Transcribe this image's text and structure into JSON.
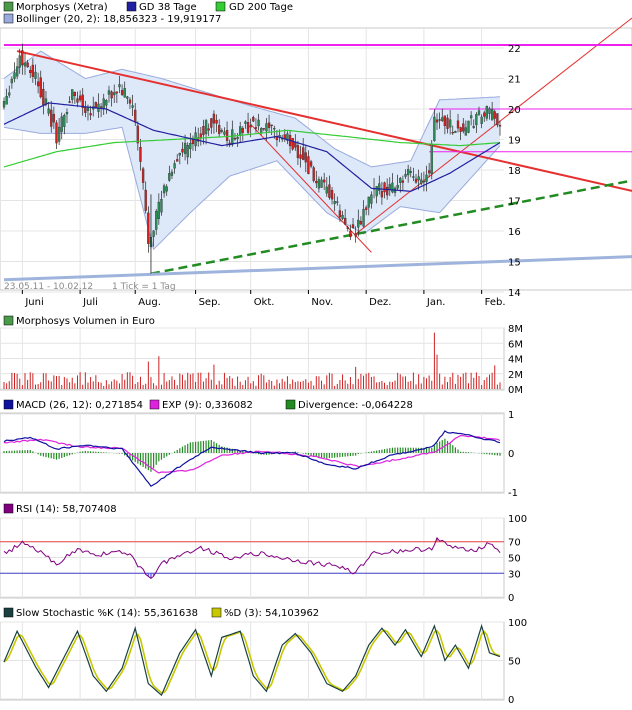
{
  "colors": {
    "price_up": "#2e8b57",
    "price_down": "#d02020",
    "gd38": "#2020a0",
    "gd200": "#33cc33",
    "bollinger_fill": "#dde8f8",
    "bollinger_line": "#99aadd",
    "trend_red": "#e53030",
    "trend_green": "#228b22",
    "trend_steel": "#9fb4dd",
    "magenta": "#ee22ee",
    "volume": "#cc2222",
    "macd": "#1010a0",
    "exp": "#dd22dd",
    "divergence": "#228b22",
    "rsi": "#800080",
    "rsi_70": "#ee4444",
    "rsi_30": "#4444cc",
    "stoch_k": "#1a4040",
    "stoch_d": "#c8c800"
  },
  "chart_data": [
    {
      "type": "line",
      "panel": "price",
      "legend": [
        {
          "label": "Morphosys (Xetra)",
          "color": "#4a9a4a"
        },
        {
          "label": "GD 38 Tage",
          "color": "#2020a0"
        },
        {
          "label": "GD 200 Tage",
          "color": "#33cc33"
        },
        {
          "label": "Bollinger (20, 2): 18,856323 - 19,919177",
          "color": "#99aadd"
        }
      ],
      "x_labels": [
        "Juni",
        "Juli",
        "Aug.",
        "Sep.",
        "Okt.",
        "Nov.",
        "Dez.",
        "Jan.",
        "Feb."
      ],
      "y_ticks": [
        "22",
        "21",
        "20",
        "19",
        "18",
        "17",
        "16",
        "15",
        "14"
      ],
      "ylim": [
        14,
        22
      ],
      "date_range_label": "23.05.11 - 10.02.12",
      "tick_label": "1 Tick = 1 Tag",
      "close_anchors": [
        [
          "2011-05-23",
          20.3
        ],
        [
          "2011-05-31",
          21.7
        ],
        [
          "2011-06-08",
          21.1
        ],
        [
          "2011-06-20",
          19.1
        ],
        [
          "2011-06-28",
          20.5
        ],
        [
          "2011-07-06",
          20.0
        ],
        [
          "2011-07-14",
          20.2
        ],
        [
          "2011-07-22",
          20.7
        ],
        [
          "2011-07-29",
          20.1
        ],
        [
          "2011-08-04",
          17.5
        ],
        [
          "2011-08-08",
          15.7
        ],
        [
          "2011-08-12",
          16.8
        ],
        [
          "2011-08-22",
          18.3
        ],
        [
          "2011-09-01",
          19.0
        ],
        [
          "2011-09-09",
          19.6
        ],
        [
          "2011-09-19",
          19.0
        ],
        [
          "2011-09-30",
          19.5
        ],
        [
          "2011-10-10",
          19.3
        ],
        [
          "2011-10-20",
          19.0
        ],
        [
          "2011-10-28",
          18.4
        ],
        [
          "2011-11-04",
          17.6
        ],
        [
          "2011-11-14",
          17.1
        ],
        [
          "2011-11-21",
          16.2
        ],
        [
          "2011-11-25",
          15.9
        ],
        [
          "2011-12-05",
          17.2
        ],
        [
          "2011-12-15",
          17.5
        ],
        [
          "2011-12-23",
          17.8
        ],
        [
          "2011-12-30",
          17.7
        ],
        [
          "2012-01-04",
          18.1
        ],
        [
          "2012-01-06",
          19.8
        ],
        [
          "2012-01-13",
          19.5
        ],
        [
          "2012-01-20",
          19.3
        ],
        [
          "2012-01-27",
          19.6
        ],
        [
          "2012-02-03",
          19.9
        ],
        [
          "2012-02-10",
          19.6
        ]
      ],
      "gd38_anchors": [
        [
          "2011-05-23",
          19.5
        ],
        [
          "2011-06-15",
          20.2
        ],
        [
          "2011-07-15",
          20.0
        ],
        [
          "2011-08-10",
          19.3
        ],
        [
          "2011-09-15",
          18.8
        ],
        [
          "2011-10-15",
          19.1
        ],
        [
          "2011-11-10",
          18.6
        ],
        [
          "2011-12-05",
          17.4
        ],
        [
          "2011-12-25",
          17.3
        ],
        [
          "2012-01-15",
          17.9
        ],
        [
          "2012-02-10",
          18.9
        ]
      ],
      "gd200_anchors": [
        [
          "2011-05-23",
          18.1
        ],
        [
          "2011-06-20",
          18.6
        ],
        [
          "2011-07-20",
          18.9
        ],
        [
          "2011-08-20",
          19.0
        ],
        [
          "2011-09-20",
          19.1
        ],
        [
          "2011-10-20",
          19.3
        ],
        [
          "2011-11-20",
          19.1
        ],
        [
          "2011-12-20",
          18.9
        ],
        [
          "2012-01-20",
          18.8
        ],
        [
          "2012-02-10",
          18.9
        ]
      ],
      "bollinger_upper_anchors": [
        [
          "2011-05-23",
          21.0
        ],
        [
          "2011-06-10",
          21.9
        ],
        [
          "2011-07-05",
          21.0
        ],
        [
          "2011-07-25",
          21.3
        ],
        [
          "2011-08-15",
          21.0
        ],
        [
          "2011-09-05",
          20.6
        ],
        [
          "2011-10-01",
          20.1
        ],
        [
          "2011-10-25",
          19.7
        ],
        [
          "2011-11-15",
          18.7
        ],
        [
          "2011-12-05",
          18.1
        ],
        [
          "2011-12-25",
          18.3
        ],
        [
          "2012-01-10",
          20.3
        ],
        [
          "2012-02-10",
          20.4
        ]
      ],
      "bollinger_lower_anchors": [
        [
          "2011-05-23",
          19.4
        ],
        [
          "2011-06-10",
          19.2
        ],
        [
          "2011-07-05",
          19.2
        ],
        [
          "2011-07-25",
          19.4
        ],
        [
          "2011-08-10",
          15.4
        ],
        [
          "2011-08-30",
          16.6
        ],
        [
          "2011-09-20",
          17.8
        ],
        [
          "2011-10-15",
          18.3
        ],
        [
          "2011-11-10",
          16.6
        ],
        [
          "2011-11-30",
          15.9
        ],
        [
          "2011-12-20",
          16.8
        ],
        [
          "2012-01-10",
          16.6
        ],
        [
          "2012-02-10",
          18.8
        ]
      ],
      "trendlines": [
        {
          "color": "#e53030",
          "style": "solid",
          "points": [
            [
              "2011-05-30",
              21.9
            ],
            [
              "2012-02-10",
              18.3
            ]
          ],
          "extend_right": true
        },
        {
          "color": "#e53030",
          "style": "thin",
          "points": [
            [
              "2011-11-25",
              15.9
            ],
            [
              "2012-02-10",
              19.6
            ]
          ],
          "extend_right": true
        },
        {
          "color": "#e53030",
          "style": "thin",
          "points": [
            [
              "2011-10-01",
              19.5
            ],
            [
              "2011-12-05",
              15.3
            ]
          ],
          "extend_right": false
        },
        {
          "color": "#228b22",
          "style": "dashed",
          "points": [
            [
              "2011-08-09",
              14.6
            ],
            [
              "2011-11-25",
              15.9
            ]
          ],
          "extend_right": true
        },
        {
          "color": "#9fb4dd",
          "style": "thick",
          "points": [
            [
              "2011-05-23",
              14.4
            ],
            [
              "2012-02-10",
              15.0
            ]
          ],
          "extend_right": true
        },
        {
          "color": "#ee22ee",
          "style": "solid",
          "points": [
            [
              "2011-05-23",
              22.1
            ],
            [
              "2012-02-10",
              22.1
            ]
          ],
          "extend_right": true
        },
        {
          "color": "#ee22ee",
          "style": "thin",
          "points": [
            [
              "2012-01-04",
              20.0
            ],
            [
              "2012-02-10",
              20.0
            ]
          ],
          "extend_right": true
        },
        {
          "color": "#ee22ee",
          "style": "thin",
          "points": [
            [
              "2012-01-04",
              18.6
            ],
            [
              "2012-02-10",
              18.6
            ]
          ],
          "extend_right": true
        }
      ]
    },
    {
      "type": "bar",
      "panel": "volume",
      "title": "Morphosys Volumen in Euro",
      "y_ticks": [
        "8M",
        "6M",
        "4M",
        "2M",
        "0M"
      ],
      "ylim": [
        0,
        8
      ],
      "unit": "M",
      "spikes": [
        [
          "2011-08-08",
          3.6
        ],
        [
          "2011-08-12",
          4.3
        ],
        [
          "2011-09-12",
          3.2
        ],
        [
          "2011-11-25",
          2.9
        ],
        [
          "2012-01-06",
          7.4
        ],
        [
          "2012-01-09",
          4.5
        ],
        [
          "2012-02-08",
          3.1
        ]
      ],
      "base_level": 1.3
    },
    {
      "type": "line",
      "panel": "macd",
      "legend": [
        {
          "label": "MACD (26, 12): 0,271854",
          "color": "#1010a0"
        },
        {
          "label": "EXP (9): 0,336082",
          "color": "#dd22dd"
        },
        {
          "label": "Divergence: -0,064228",
          "color": "#228b22"
        }
      ],
      "y_ticks": [
        "1",
        "0",
        "-1"
      ],
      "ylim": [
        -1,
        1
      ],
      "macd_anchors": [
        [
          "2011-05-23",
          0.3
        ],
        [
          "2011-06-05",
          0.4
        ],
        [
          "2011-06-20",
          0.1
        ],
        [
          "2011-07-05",
          0.2
        ],
        [
          "2011-07-25",
          0.1
        ],
        [
          "2011-08-09",
          -0.85
        ],
        [
          "2011-08-25",
          -0.3
        ],
        [
          "2011-09-10",
          0.15
        ],
        [
          "2011-10-05",
          0.0
        ],
        [
          "2011-10-25",
          0.0
        ],
        [
          "2011-11-10",
          -0.3
        ],
        [
          "2011-11-25",
          -0.4
        ],
        [
          "2011-12-15",
          -0.05
        ],
        [
          "2012-01-05",
          0.15
        ],
        [
          "2012-01-12",
          0.55
        ],
        [
          "2012-01-25",
          0.45
        ],
        [
          "2012-02-10",
          0.27
        ]
      ],
      "exp_anchors": [
        [
          "2011-05-23",
          0.25
        ],
        [
          "2011-06-10",
          0.35
        ],
        [
          "2011-07-01",
          0.15
        ],
        [
          "2011-07-25",
          0.12
        ],
        [
          "2011-08-12",
          -0.5
        ],
        [
          "2011-08-30",
          -0.45
        ],
        [
          "2011-09-15",
          -0.05
        ],
        [
          "2011-10-10",
          0.05
        ],
        [
          "2011-11-05",
          -0.1
        ],
        [
          "2011-11-28",
          -0.35
        ],
        [
          "2011-12-20",
          -0.15
        ],
        [
          "2012-01-08",
          0.05
        ],
        [
          "2012-01-20",
          0.45
        ],
        [
          "2012-02-10",
          0.34
        ]
      ]
    },
    {
      "type": "line",
      "panel": "rsi",
      "legend": [
        {
          "label": "RSI (14): 58,707408",
          "color": "#800080"
        }
      ],
      "y_ticks": [
        "100",
        "70",
        "50",
        "30",
        "0"
      ],
      "ylim": [
        0,
        100
      ],
      "reference_labels": [
        "70",
        "30"
      ],
      "reference_levels": [
        70,
        30
      ],
      "rsi_anchors": [
        [
          "2011-05-23",
          55
        ],
        [
          "2011-06-01",
          68
        ],
        [
          "2011-06-10",
          56
        ],
        [
          "2011-06-20",
          42
        ],
        [
          "2011-06-30",
          60
        ],
        [
          "2011-07-10",
          53
        ],
        [
          "2011-07-20",
          58
        ],
        [
          "2011-07-28",
          52
        ],
        [
          "2011-08-05",
          30
        ],
        [
          "2011-08-09",
          25
        ],
        [
          "2011-08-15",
          42
        ],
        [
          "2011-08-25",
          55
        ],
        [
          "2011-09-05",
          62
        ],
        [
          "2011-09-20",
          50
        ],
        [
          "2011-10-05",
          55
        ],
        [
          "2011-10-20",
          48
        ],
        [
          "2011-11-05",
          42
        ],
        [
          "2011-11-15",
          40
        ],
        [
          "2011-11-25",
          31
        ],
        [
          "2011-12-05",
          55
        ],
        [
          "2011-12-20",
          58
        ],
        [
          "2012-01-05",
          62
        ],
        [
          "2012-01-09",
          73
        ],
        [
          "2012-01-15",
          63
        ],
        [
          "2012-01-30",
          60
        ],
        [
          "2012-02-05",
          68
        ],
        [
          "2012-02-10",
          59
        ]
      ]
    },
    {
      "type": "line",
      "panel": "stochastic",
      "legend": [
        {
          "label": "Slow Stochastic %K (14): 55,361638",
          "color": "#1a4040"
        },
        {
          "label": "%D (3): 54,103962",
          "color": "#c8c800"
        }
      ],
      "y_ticks": [
        "100",
        "50",
        "0"
      ],
      "ylim": [
        0,
        100
      ],
      "k_anchors": [
        [
          "2011-05-23",
          48
        ],
        [
          "2011-05-30",
          88
        ],
        [
          "2011-06-08",
          42
        ],
        [
          "2011-06-15",
          15
        ],
        [
          "2011-06-23",
          55
        ],
        [
          "2011-06-30",
          88
        ],
        [
          "2011-07-08",
          30
        ],
        [
          "2011-07-15",
          10
        ],
        [
          "2011-07-25",
          40
        ],
        [
          "2011-08-01",
          92
        ],
        [
          "2011-08-08",
          20
        ],
        [
          "2011-08-15",
          5
        ],
        [
          "2011-08-24",
          60
        ],
        [
          "2011-09-01",
          90
        ],
        [
          "2011-09-09",
          30
        ],
        [
          "2011-09-15",
          80
        ],
        [
          "2011-09-25",
          88
        ],
        [
          "2011-10-03",
          30
        ],
        [
          "2011-10-10",
          10
        ],
        [
          "2011-10-18",
          70
        ],
        [
          "2011-10-25",
          85
        ],
        [
          "2011-11-02",
          60
        ],
        [
          "2011-11-10",
          20
        ],
        [
          "2011-11-18",
          10
        ],
        [
          "2011-11-25",
          30
        ],
        [
          "2011-12-03",
          70
        ],
        [
          "2011-12-10",
          92
        ],
        [
          "2011-12-16",
          70
        ],
        [
          "2011-12-22",
          90
        ],
        [
          "2011-12-30",
          55
        ],
        [
          "2012-01-06",
          95
        ],
        [
          "2012-01-12",
          50
        ],
        [
          "2012-01-18",
          70
        ],
        [
          "2012-01-25",
          40
        ],
        [
          "2012-02-01",
          95
        ],
        [
          "2012-02-06",
          60
        ],
        [
          "2012-02-10",
          55
        ]
      ]
    }
  ]
}
